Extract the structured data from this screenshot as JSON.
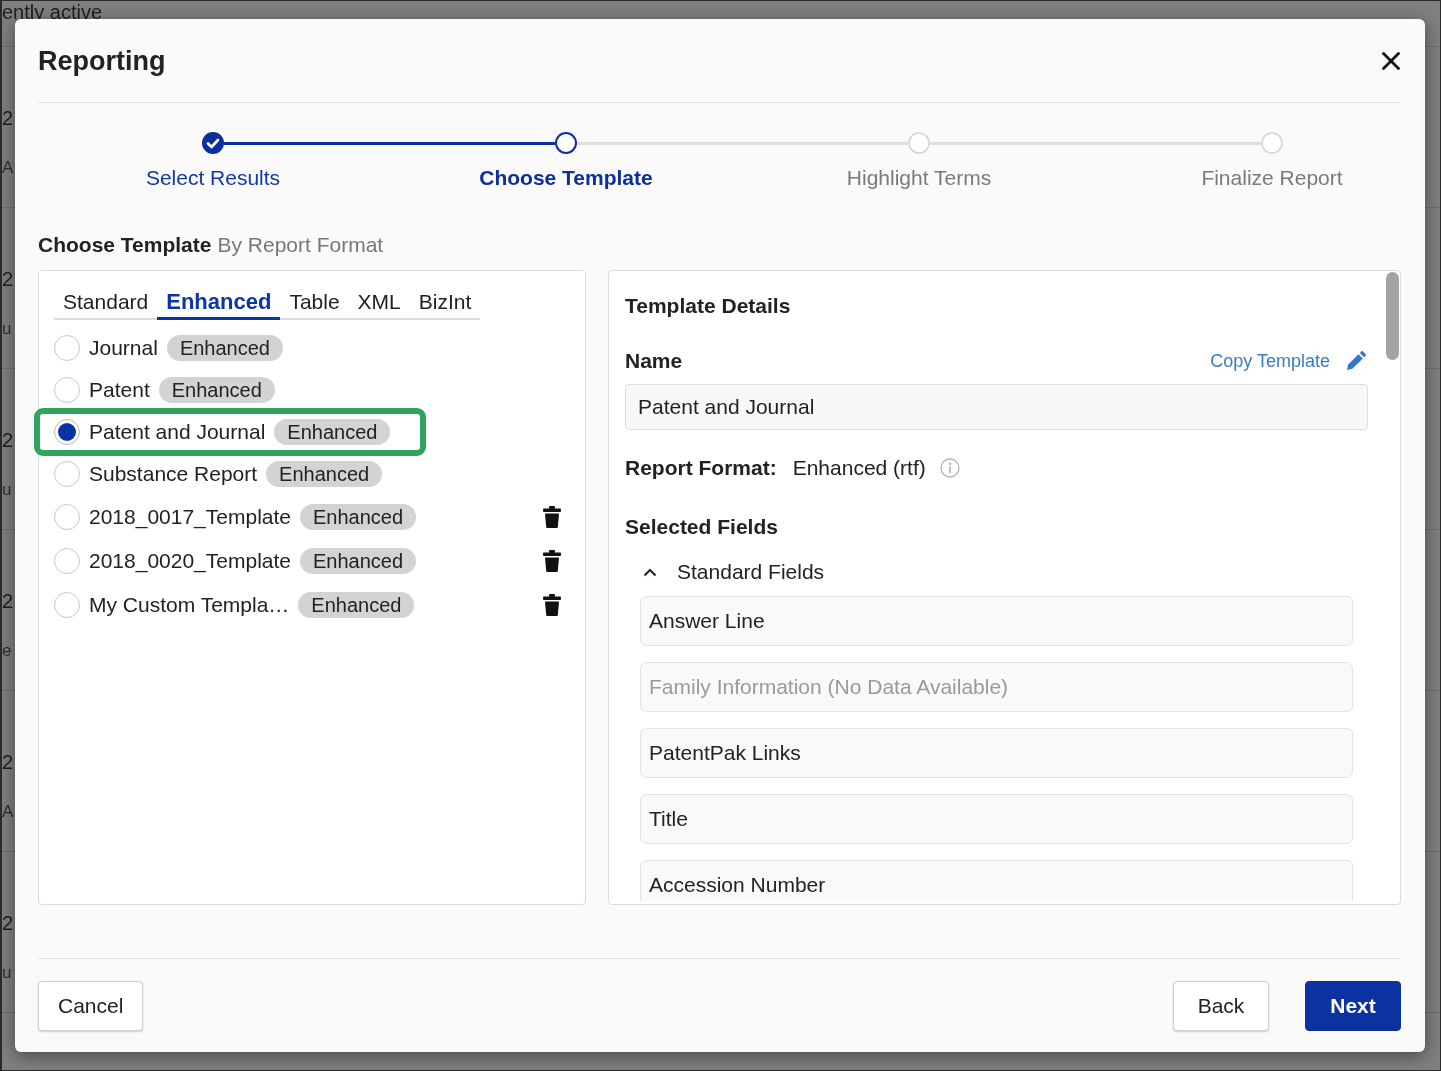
{
  "background": {
    "header_text": "ently active",
    "rows": [
      {
        "line_1": "2",
        "line_2": "A"
      },
      {
        "line_1": "2",
        "line_2": "u"
      },
      {
        "line_1": "2",
        "line_2": "u"
      },
      {
        "line_1": "2",
        "line_2": "e"
      },
      {
        "line_1": "2",
        "line_2": "A"
      },
      {
        "line_1": "2",
        "line_2": "u"
      }
    ]
  },
  "dialog": {
    "title": "Reporting",
    "steps": [
      {
        "label": "Select Results",
        "completed": true,
        "current": false
      },
      {
        "label": "Choose Template",
        "completed": false,
        "current": true
      },
      {
        "label": "Highlight Terms",
        "completed": false,
        "current": false
      },
      {
        "label": "Finalize Report",
        "completed": false,
        "current": false
      }
    ],
    "section": {
      "title": "Choose Template",
      "subtitle": "By Report Format"
    },
    "format_tabs": [
      {
        "label": "Standard",
        "selected": false
      },
      {
        "label": "Enhanced",
        "selected": true
      },
      {
        "label": "Table",
        "selected": false
      },
      {
        "label": "XML",
        "selected": false
      },
      {
        "label": "BizInt",
        "selected": false
      }
    ],
    "templates": [
      {
        "name": "Journal",
        "badge": "Enhanced",
        "selected": false,
        "highlighted": false,
        "deletable": false
      },
      {
        "name": "Patent",
        "badge": "Enhanced",
        "selected": false,
        "highlighted": false,
        "deletable": false
      },
      {
        "name": "Patent and Journal",
        "badge": "Enhanced",
        "selected": true,
        "highlighted": true,
        "deletable": false
      },
      {
        "name": "Substance Report",
        "badge": "Enhanced",
        "selected": false,
        "highlighted": false,
        "deletable": false
      },
      {
        "name": "2018_0017_Template",
        "badge": "Enhanced",
        "selected": false,
        "highlighted": false,
        "deletable": true
      },
      {
        "name": "2018_0020_Template",
        "badge": "Enhanced",
        "selected": false,
        "highlighted": false,
        "deletable": true
      },
      {
        "name": "My Custom Templa…",
        "badge": "Enhanced",
        "selected": false,
        "highlighted": false,
        "deletable": true
      }
    ],
    "details": {
      "title": "Template Details",
      "name_label": "Name",
      "copy_link": "Copy Template",
      "name_value": "Patent and Journal",
      "format_label": "Report Format:",
      "format_value": "Enhanced (rtf)",
      "fields_label": "Selected Fields",
      "field_groups": [
        {
          "label": "Standard Fields",
          "expanded": true,
          "fields": [
            {
              "label": "Answer Line",
              "disabled": false
            },
            {
              "label": "Family Information (No Data Available)",
              "disabled": true
            },
            {
              "label": "PatentPak Links",
              "disabled": false
            },
            {
              "label": "Title",
              "disabled": false
            },
            {
              "label": "Accession Number",
              "disabled": false
            }
          ]
        }
      ]
    },
    "footer": {
      "left_buttons": [
        {
          "label": "Cancel",
          "kind": "secondary"
        }
      ],
      "right_buttons": [
        {
          "label": "Back",
          "kind": "secondary"
        },
        {
          "label": "Next",
          "kind": "primary"
        }
      ]
    }
  }
}
